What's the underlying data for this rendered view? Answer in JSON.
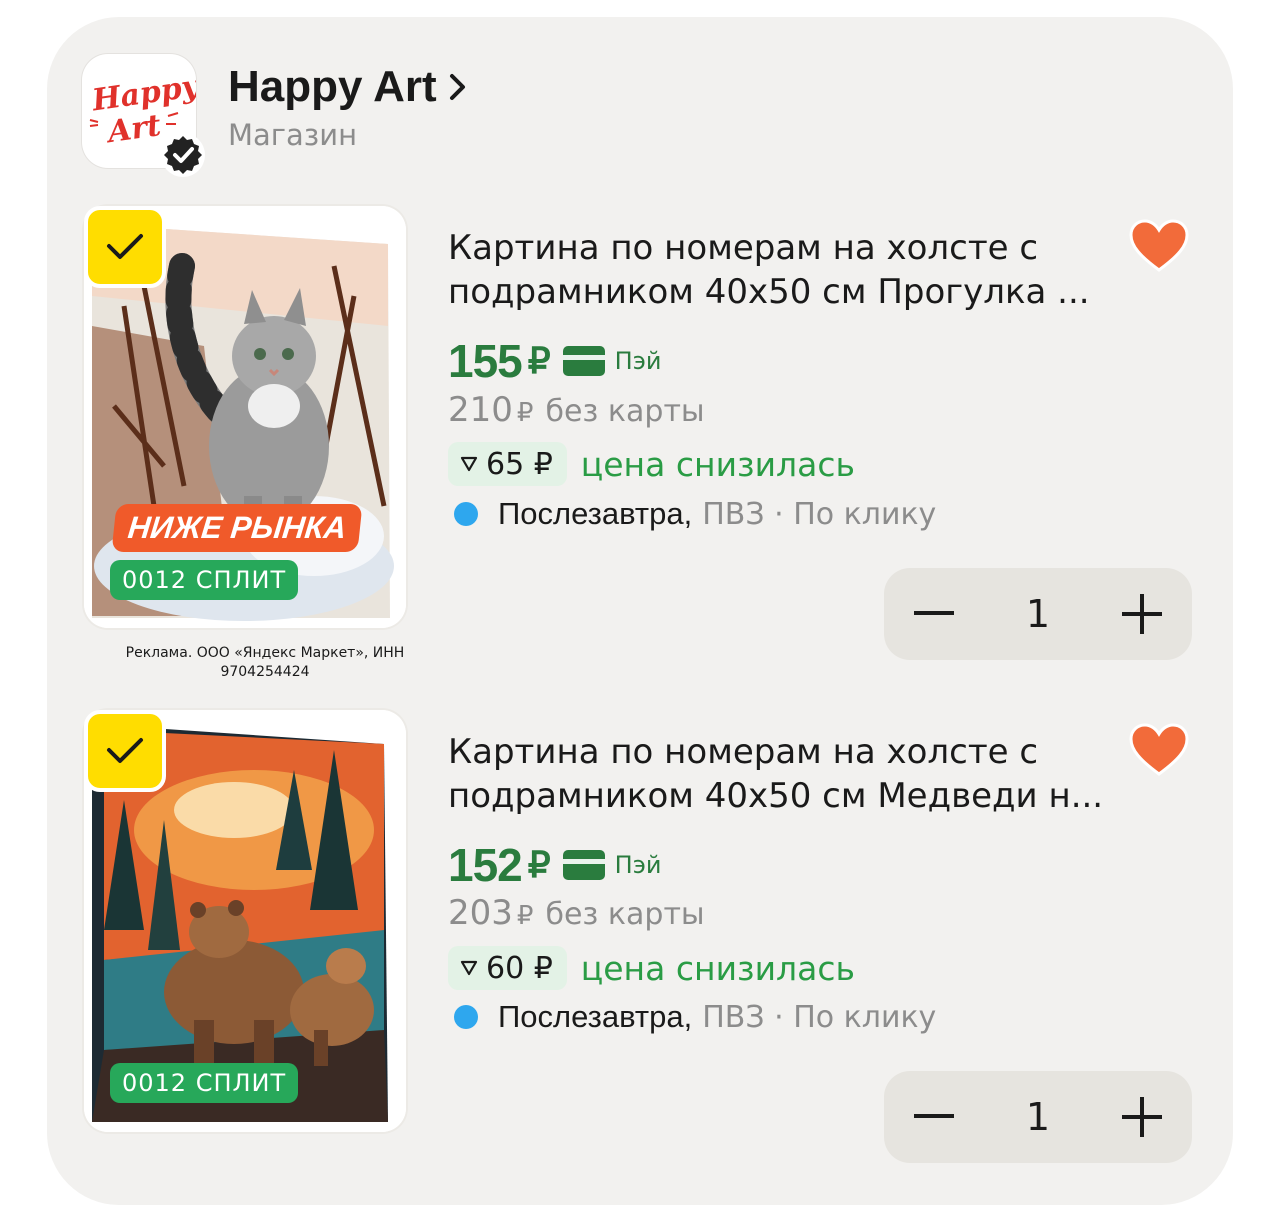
{
  "shop": {
    "logo_text_line1": "Happy",
    "logo_text_line2": "Art",
    "name": "Happy Art",
    "subtitle": "Магазин",
    "chevron_icon": "chevron-right-icon",
    "verified_icon": "verified-badge-icon"
  },
  "ad_note": "Реклама. ООО «Яндекс Маркет», ИНН 9704254424",
  "products": [
    {
      "title": "Картина по номерам на холсте с подрамником 40x50 см Прогулка ...",
      "price": "155",
      "currency": "₽",
      "pay_label": "Пэй",
      "old_price": "210",
      "old_currency": "₽",
      "old_label": "без карты",
      "drop_amount": "65 ₽",
      "drop_label": "цена снизилась",
      "delivery_day": "Послезавтра,",
      "delivery_rest": "ПВЗ · По клику",
      "quantity": "1",
      "badge_market": "НИЖЕ РЫНКА",
      "badge_split": "0012 СПЛИТ",
      "selected": true,
      "favorite": true,
      "image_subject": "cat-painting"
    },
    {
      "title": "Картина по номерам на холсте с подрамником 40x50 см Медведи н...",
      "price": "152",
      "currency": "₽",
      "pay_label": "Пэй",
      "old_price": "203",
      "old_currency": "₽",
      "old_label": "без карты",
      "drop_amount": "60 ₽",
      "drop_label": "цена снизилась",
      "delivery_day": "Послезавтра,",
      "delivery_rest": "ПВЗ · По клику",
      "quantity": "1",
      "badge_split": "0012 СПЛИТ",
      "selected": true,
      "favorite": true,
      "image_subject": "bears-painting"
    }
  ],
  "colors": {
    "price_green": "#2a7c3e",
    "drop_green": "#2a9c45",
    "check_yellow": "#ffdd00",
    "heart_orange": "#f26b3a",
    "delivery_dot": "#2ea7ee",
    "badge_orange": "#f05a2a",
    "badge_green": "#27a85a"
  }
}
